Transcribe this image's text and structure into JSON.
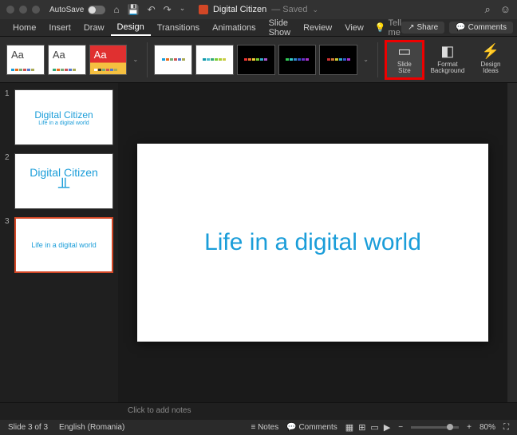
{
  "titlebar": {
    "autosave_label": "AutoSave",
    "autosave_state": "OFF",
    "doc_title": "Digital Citizen",
    "doc_status": "— Saved"
  },
  "tabs": {
    "items": [
      "Home",
      "Insert",
      "Draw",
      "Design",
      "Transitions",
      "Animations",
      "Slide Show",
      "Review",
      "View"
    ],
    "active": "Design",
    "tell_me": "Tell me",
    "share": "Share",
    "comments": "Comments"
  },
  "ribbon": {
    "theme_label": "Aa",
    "slide_size": "Slide\nSize",
    "format_bg": "Format\nBackground",
    "design_ideas": "Design\nIdeas"
  },
  "thumbs": [
    {
      "num": "1",
      "line1": "Digital Citizen",
      "line2": "Life in a digital world"
    },
    {
      "num": "2",
      "line1": "Digital Citizen"
    },
    {
      "num": "3",
      "line1": "Life in a digital world"
    }
  ],
  "canvas": {
    "text": "Life in a digital world"
  },
  "notes": {
    "placeholder": "Click to add notes"
  },
  "status": {
    "slide": "Slide 3 of 3",
    "lang": "English (Romania)",
    "notes": "Notes",
    "comments": "Comments",
    "zoom": "80%"
  }
}
